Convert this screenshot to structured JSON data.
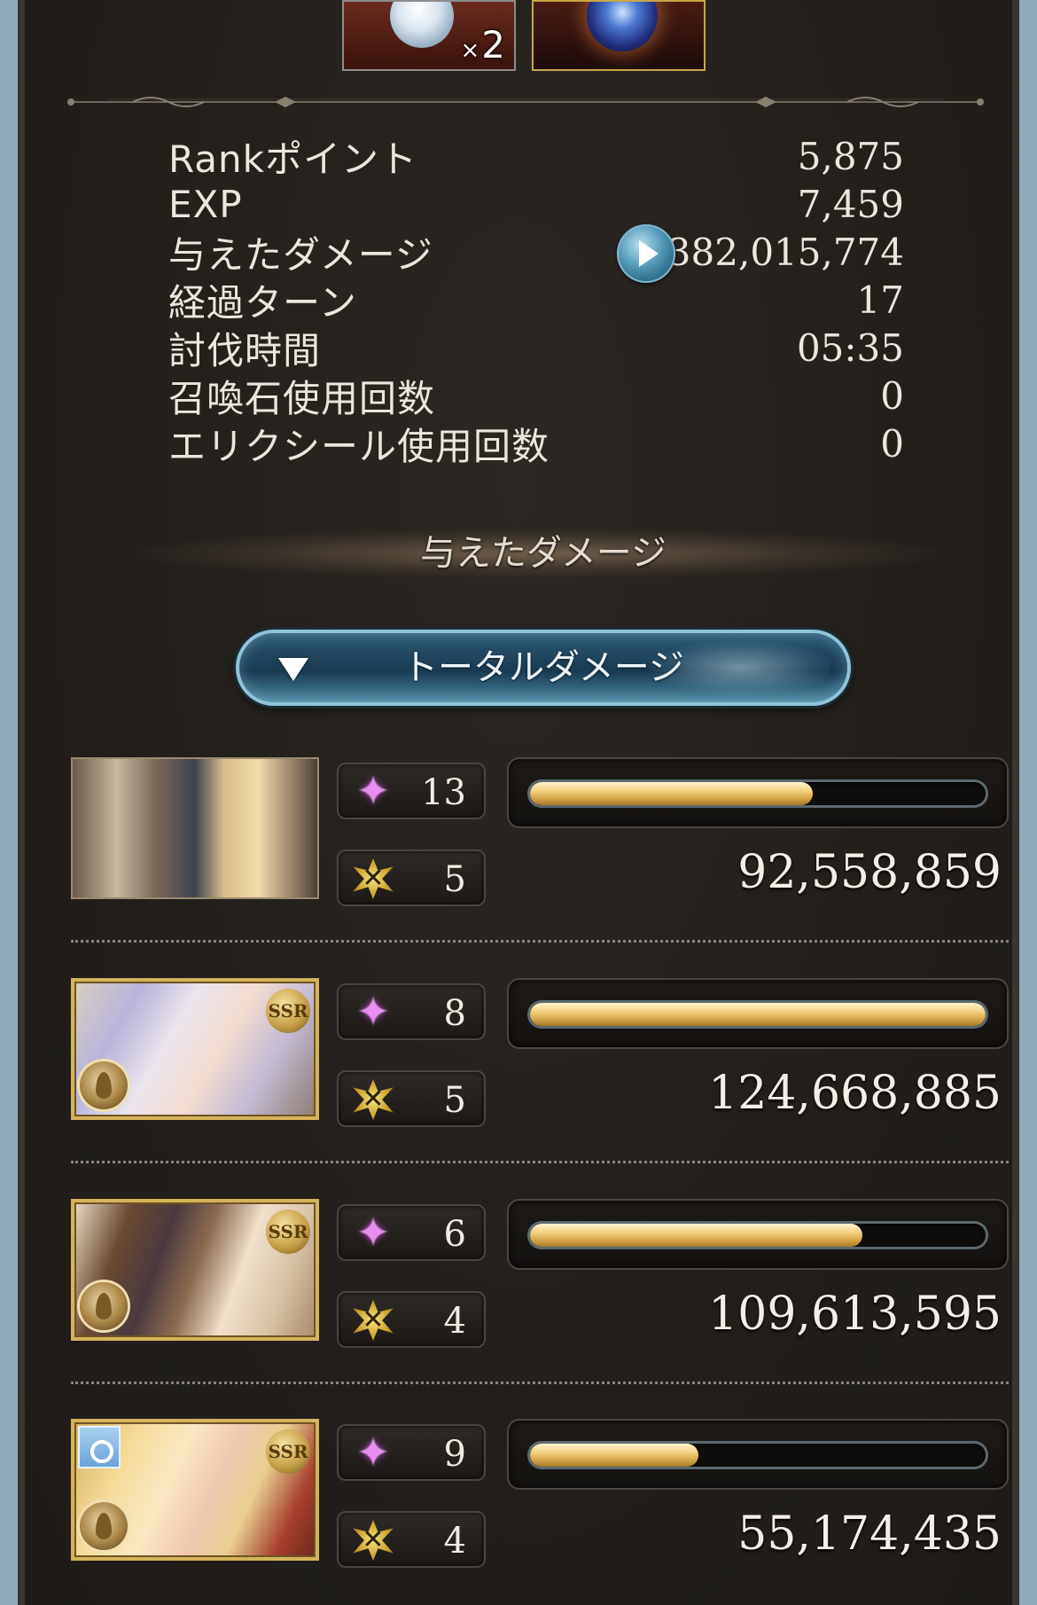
{
  "items": [
    {
      "icon": "crystal-orb-icon",
      "quantity_prefix": "×",
      "quantity": "2"
    },
    {
      "icon": "blue-orb-icon"
    }
  ],
  "stats": [
    {
      "label": "Rankポイント",
      "value": "5,875"
    },
    {
      "label": "EXP",
      "value": "7,459"
    },
    {
      "label": "与えたダメージ",
      "value": "382,015,774"
    },
    {
      "label": "経過ターン",
      "value": "17"
    },
    {
      "label": "討伐時間",
      "value": "05:35"
    },
    {
      "label": "召喚石使用回数",
      "value": "0"
    },
    {
      "label": "エリクシール使用回数",
      "value": "0"
    }
  ],
  "section_title": "与えたダメージ",
  "dropdown": {
    "label": "トータルダメージ",
    "icon": "triangle-down-icon"
  },
  "characters": [
    {
      "portrait": "main-character-portrait",
      "rarity": "",
      "star_count": "13",
      "ability_count": "5",
      "damage": "92,558,859",
      "bar_fraction": 0.62
    },
    {
      "portrait": "character-2-portrait",
      "rarity": "SSR",
      "star_count": "8",
      "ability_count": "5",
      "damage": "124,668,885",
      "bar_fraction": 1.0
    },
    {
      "portrait": "character-3-portrait",
      "rarity": "SSR",
      "star_count": "6",
      "ability_count": "4",
      "damage": "109,613,595",
      "bar_fraction": 0.73
    },
    {
      "portrait": "character-4-portrait",
      "rarity": "SSR",
      "star_count": "9",
      "ability_count": "4",
      "damage": "55,174,435",
      "bar_fraction": 0.37
    }
  ],
  "colors": {
    "background": "#25221e",
    "bar_gold": "#f1cf7d",
    "accent_blue": "#4f95b4",
    "text": "#ece6dc"
  }
}
